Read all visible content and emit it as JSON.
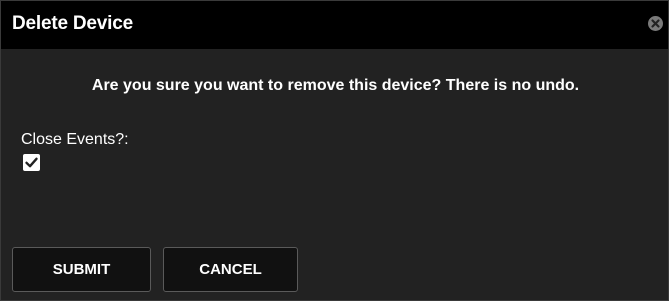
{
  "dialog": {
    "title": "Delete Device",
    "message": "Are you sure you want to remove this device? There is no undo.",
    "close_icon": "close-circle-icon",
    "field": {
      "label": "Close Events?:",
      "checked": true,
      "check_icon": "checkmark-icon"
    },
    "buttons": {
      "submit_label": "SUBMIT",
      "cancel_label": "CANCEL"
    }
  },
  "colors": {
    "titlebar": "#000000",
    "body": "#222222",
    "text": "#ffffff",
    "button_bg": "#111111",
    "button_border": "#5a5a5a",
    "close_icon": "#7a7a7a"
  }
}
